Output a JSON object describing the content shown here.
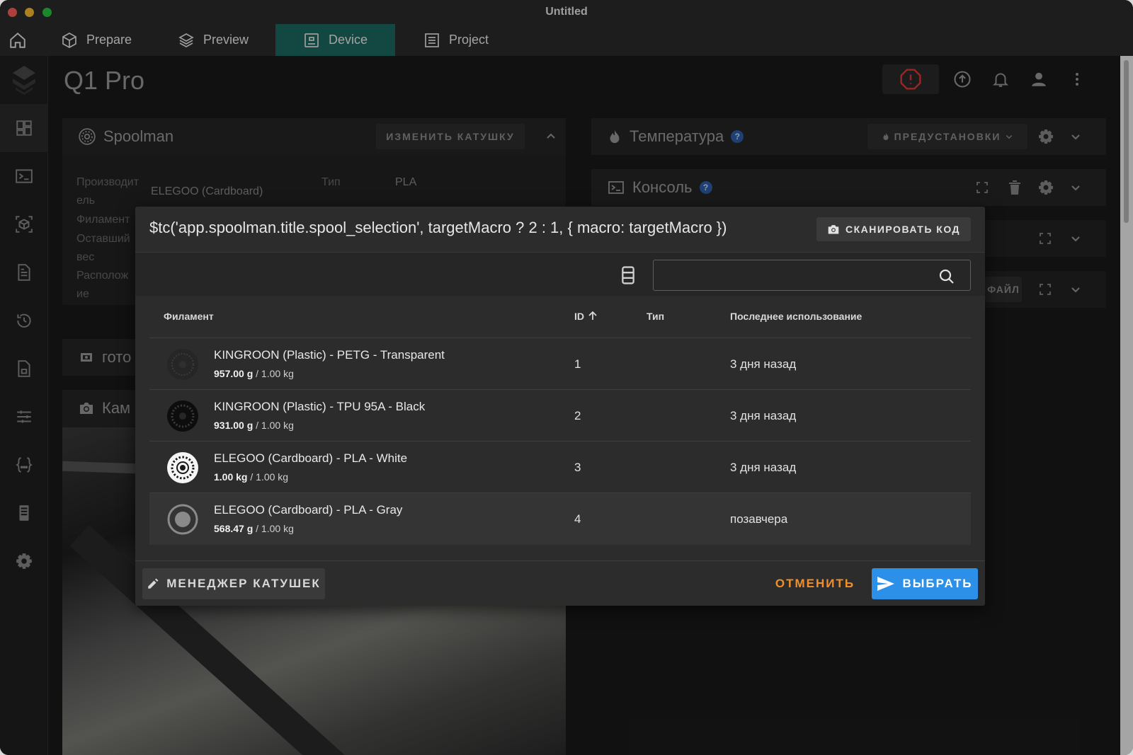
{
  "window": {
    "title": "Untitled"
  },
  "app_tabs": [
    {
      "label": "Prepare"
    },
    {
      "label": "Preview"
    },
    {
      "label": "Device"
    },
    {
      "label": "Project"
    }
  ],
  "header": {
    "printer_name": "Q1 Pro"
  },
  "spoolman_card": {
    "title": "Spoolman",
    "change_button": "ИЗМЕНИТЬ КАТУШКУ",
    "labels": {
      "manufacturer": "Производит\nель",
      "filament": "Филамент",
      "remaining": "Оставший\nвес",
      "location": "Располож\nие",
      "type": "Тип"
    },
    "values": {
      "manufacturer": "ELEGOO (Cardboard)",
      "type": "PLA"
    }
  },
  "ready_card": {
    "title": "гото"
  },
  "camera_card": {
    "title": "Кам"
  },
  "temperature_card": {
    "title": "Температура",
    "help": "?",
    "presets_button": "ПРЕДУСТАНОВКИ"
  },
  "console_card": {
    "title": "Консоль",
    "help": "?"
  },
  "file_card": {
    "button_fragment": "ФАЙЛ"
  },
  "dialog": {
    "title": "$tc('app.spoolman.title.spool_selection', targetMacro ? 2 : 1, { macro: targetMacro })",
    "scan_button": "СКАНИРОВАТЬ КОД",
    "search": {
      "value": "",
      "placeholder": ""
    },
    "columns": {
      "filament": "Филамент",
      "id": "ID",
      "type": "Тип",
      "last_used": "Последнее использование"
    },
    "rows": [
      {
        "name": "KINGROON (Plastic) - PETG - Transparent",
        "weight": "957.00 g",
        "total": " / 1.00 kg",
        "id": "1",
        "type": "",
        "last_used": "3 дня назад"
      },
      {
        "name": "KINGROON (Plastic) - TPU 95A - Black",
        "weight": "931.00 g",
        "total": " / 1.00 kg",
        "id": "2",
        "type": "",
        "last_used": "3 дня назад"
      },
      {
        "name": "ELEGOO (Cardboard) - PLA - White",
        "weight": "1.00 kg",
        "total": " / 1.00 kg",
        "id": "3",
        "type": "",
        "last_used": "3 дня назад"
      },
      {
        "name": "ELEGOO (Cardboard) - PLA - Gray",
        "weight": "568.47 g",
        "total": " / 1.00 kg",
        "id": "4",
        "type": "",
        "last_used": "позавчера"
      }
    ],
    "manager_button": "МЕНЕДЖЕР КАТУШЕК",
    "cancel_button": "ОТМЕНИТЬ",
    "select_button": "ВЫБРАТЬ"
  },
  "colors": {
    "accent_device_tab": "#1b6b61",
    "primary": "#2c8fe8",
    "cancel": "#f0902d",
    "warning": "#e53935"
  },
  "icons": [
    "home-icon",
    "cube-icon",
    "layers-icon",
    "device-icon",
    "list-icon",
    "dashboard-icon",
    "console-icon",
    "3d-icon",
    "file-icon",
    "history-icon",
    "gcode-icon",
    "tune-icon",
    "macros-icon",
    "sd-card-icon",
    "gear-icon",
    "emergency-stop-icon",
    "update-icon",
    "bell-icon",
    "user-icon",
    "more-vert-icon",
    "camera-icon",
    "search-icon",
    "columns-icon",
    "pencil-icon",
    "send-icon"
  ]
}
